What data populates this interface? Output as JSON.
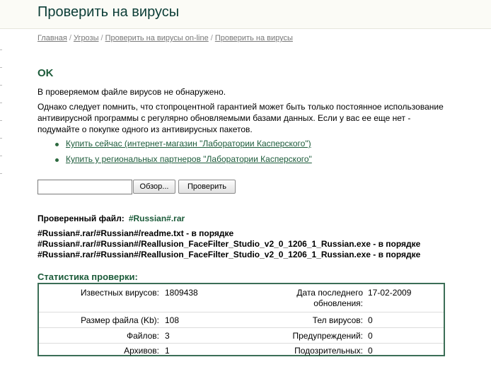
{
  "header": {
    "title": "Проверить на вирусы"
  },
  "breadcrumb": {
    "items": [
      "Главная",
      "Угрозы",
      "Проверить на вирусы on-line",
      "Проверить на вирусы"
    ],
    "separator": "/"
  },
  "status": {
    "heading": "OK",
    "result": "В проверяемом файле вирусов не обнаружено.",
    "advice": "Однако следует помнить, что стопроцентной гарантией может быть только постоянное использование антивирусной программы с регулярно обновляемыми базами данных. Если у вас ее еще нет - подумайте о покупке одного из антивирусных пакетов."
  },
  "links": [
    "Купить сейчас (интернет-магазин \"Лаборатории Касперского\")",
    "Купить у региональных партнеров \"Лаборатории Касперского\""
  ],
  "upload": {
    "file_value": "",
    "browse_label": "Обзор...",
    "check_label": "Проверить"
  },
  "checked_file": {
    "label": "Проверенный файл:",
    "name": "#Russian#.rar"
  },
  "results": [
    {
      "path": "#Russian#.rar/#Russian#/readme.txt",
      "status": "- в порядке"
    },
    {
      "path": "#Russian#.rar/#Russian#/Reallusion_FaceFilter_Studio_v2_0_1206_1_Russian.exe",
      "status": "- в порядке"
    },
    {
      "path": "#Russian#.rar/#Russian#/Reallusion_FaceFilter_Studio_v2_0_1206_1_Russian.exe",
      "status": "- в порядке"
    }
  ],
  "stats": {
    "title": "Статистика проверки:",
    "known_viruses_label": "Известных вирусов:",
    "known_viruses": "1809438",
    "update_date_label": "Дата последнего обновления:",
    "update_date": "17-02-2009",
    "file_size_label": "Размер файла (Kb):",
    "file_size": "108",
    "virus_bodies_label": "Тел вирусов:",
    "virus_bodies": "0",
    "files_label": "Файлов:",
    "files": "3",
    "warnings_label": "Предупреждений:",
    "warnings": "0",
    "archives_label": "Архивов:",
    "archives": "1",
    "suspicious_label": "Подозрительных:",
    "suspicious": "0"
  },
  "colors": {
    "accent": "#1c5b3a",
    "title": "#0b3d36",
    "box_border": "#3b6e56"
  }
}
